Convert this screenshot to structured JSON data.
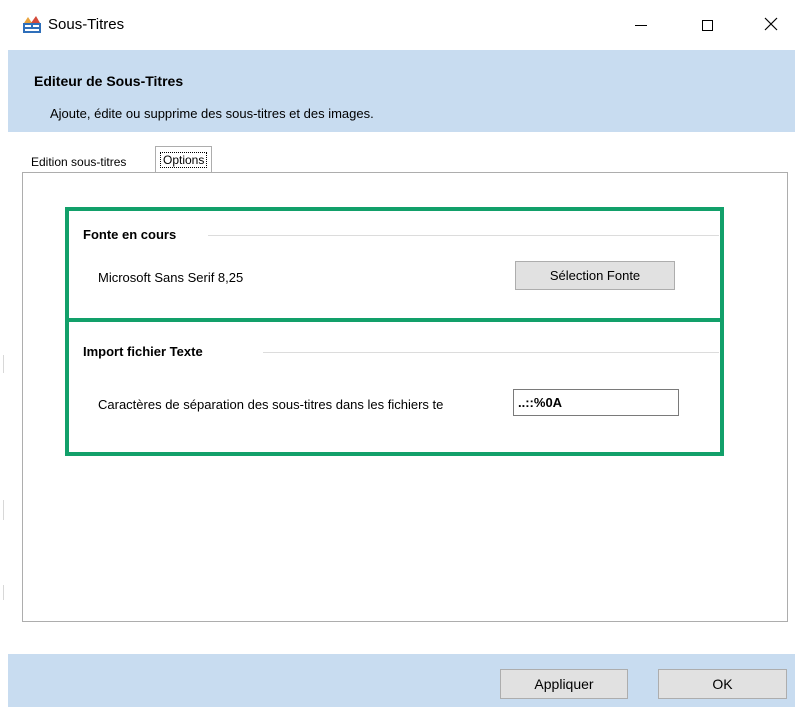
{
  "window": {
    "title": "Sous-Titres",
    "controls": {
      "minimize": "minimize",
      "maximize": "maximize",
      "close": "close"
    }
  },
  "header": {
    "title": "Editeur de Sous-Titres",
    "subtitle": "Ajoute, édite ou supprime des sous-titres et des images."
  },
  "tabs": [
    {
      "label": "Edition sous-titres",
      "selected": false
    },
    {
      "label": "Options",
      "selected": true
    }
  ],
  "font_group": {
    "title": "Fonte en cours",
    "current_font": "Microsoft Sans Serif 8,25",
    "button_label": "Sélection Fonte"
  },
  "import_group": {
    "title": "Import fichier Texte",
    "separator_label": "Caractères de séparation des sous-titres dans les fichiers te",
    "separator_value": "..::%0A"
  },
  "footer": {
    "apply_label": "Appliquer",
    "ok_label": "OK"
  },
  "colors": {
    "header_bg": "#c8dcf0",
    "highlight": "#12a06a"
  },
  "icons": {
    "app": "subtitles-app-icon",
    "minimize": "minimize-icon",
    "maximize": "maximize-icon",
    "close": "close-icon"
  }
}
